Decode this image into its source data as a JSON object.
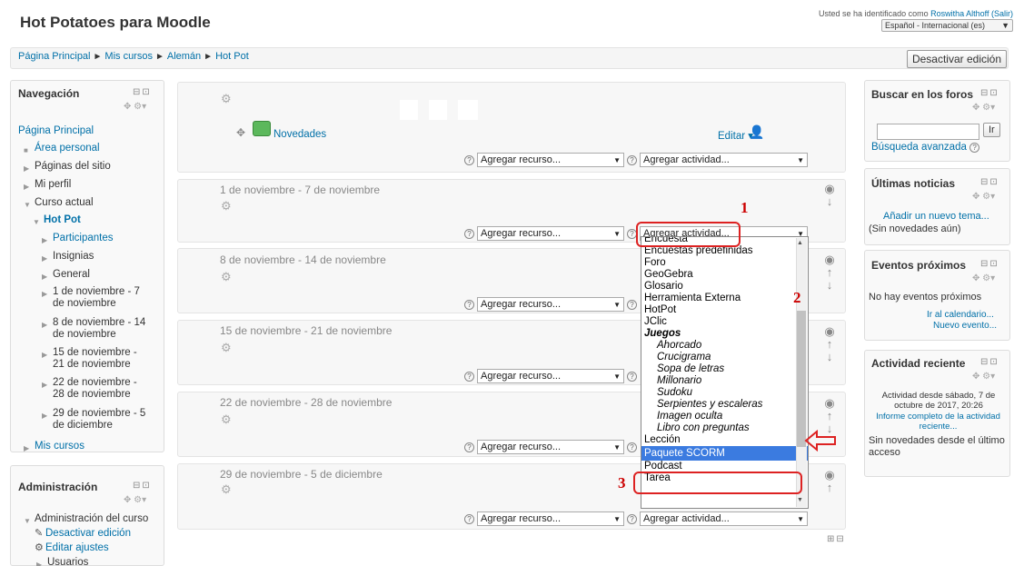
{
  "header": {
    "site_title": "Hot Potatoes para Moodle",
    "login_prefix": "Usted se ha identificado como ",
    "user_name": "Roswitha Althoff",
    "logout": "(Salir)",
    "language": "Español - Internacional (es)"
  },
  "breadcrumb": [
    "Página Principal",
    "Mis cursos",
    "Alemán",
    "Hot Pot"
  ],
  "edit_button": "Desactivar edición",
  "navigation": {
    "title": "Navegación",
    "items": [
      {
        "label": "Página Principal"
      },
      {
        "label": "Área personal"
      },
      {
        "label": "Páginas del sitio"
      },
      {
        "label": "Mi perfil"
      },
      {
        "label": "Curso actual"
      },
      {
        "label": "Hot Pot"
      },
      {
        "label": "Participantes"
      },
      {
        "label": "Insignias"
      },
      {
        "label": "General"
      },
      {
        "label": "1 de noviembre - 7 de noviembre"
      },
      {
        "label": "8 de noviembre - 14 de noviembre"
      },
      {
        "label": "15 de noviembre - 21 de noviembre"
      },
      {
        "label": "22 de noviembre - 28 de noviembre"
      },
      {
        "label": "29 de noviembre - 5 de diciembre"
      },
      {
        "label": "Mis cursos"
      }
    ]
  },
  "administration": {
    "title": "Administración",
    "items": [
      {
        "label": "Administración del curso"
      },
      {
        "label": "Desactivar edición"
      },
      {
        "label": "Editar ajustes"
      },
      {
        "label": "Usuarios"
      }
    ]
  },
  "course": {
    "news_label": "Novedades",
    "edit_label": "Editar",
    "add_resource": "Agregar recurso...",
    "add_activity": "Agregar actividad...",
    "sections": [
      {
        "title": "1 de noviembre - 7 de noviembre"
      },
      {
        "title": "8 de noviembre - 14 de noviembre"
      },
      {
        "title": "15 de noviembre - 21 de noviembre"
      },
      {
        "title": "22 de noviembre - 28 de noviembre"
      },
      {
        "title": "29 de noviembre - 5 de diciembre"
      }
    ]
  },
  "dropdown": {
    "items": [
      {
        "label": "Encuesta",
        "kind": "normal"
      },
      {
        "label": "Encuestas predefinidas",
        "kind": "normal"
      },
      {
        "label": "Foro",
        "kind": "normal"
      },
      {
        "label": "GeoGebra",
        "kind": "normal"
      },
      {
        "label": "Glosario",
        "kind": "normal"
      },
      {
        "label": "Herramienta Externa",
        "kind": "normal"
      },
      {
        "label": "HotPot",
        "kind": "normal"
      },
      {
        "label": "JClic",
        "kind": "normal"
      },
      {
        "label": "Juegos",
        "kind": "group"
      },
      {
        "label": "Ahorcado",
        "kind": "sub"
      },
      {
        "label": "Crucigrama",
        "kind": "sub"
      },
      {
        "label": "Sopa de letras",
        "kind": "sub"
      },
      {
        "label": "Millonario",
        "kind": "sub"
      },
      {
        "label": "Sudoku",
        "kind": "sub"
      },
      {
        "label": "Serpientes y escaleras",
        "kind": "sub"
      },
      {
        "label": "Imagen oculta",
        "kind": "sub"
      },
      {
        "label": "Libro con preguntas",
        "kind": "sub"
      },
      {
        "label": "Lección",
        "kind": "normal"
      },
      {
        "label": "Paquete SCORM",
        "kind": "selected"
      },
      {
        "label": "Podcast",
        "kind": "normal"
      },
      {
        "label": "Tarea",
        "kind": "normal"
      }
    ]
  },
  "annotations": [
    "1",
    "2",
    "3"
  ],
  "search_forums": {
    "title": "Buscar en los foros",
    "go": "Ir",
    "advanced": "Búsqueda avanzada"
  },
  "latest_news": {
    "title": "Últimas noticias",
    "add_topic": "Añadir un nuevo tema...",
    "none": "(Sin novedades aún)"
  },
  "upcoming_events": {
    "title": "Eventos próximos",
    "none": "No hay eventos próximos",
    "calendar": "Ir al calendario...",
    "new_event": "Nuevo evento..."
  },
  "recent_activity": {
    "title": "Actividad reciente",
    "since": "Actividad desde sábado, 7 de octubre de 2017, 20:26",
    "full_report": "Informe completo de la actividad reciente...",
    "none": "Sin novedades desde el último acceso"
  },
  "colors": {
    "link": "#0070a8",
    "annotation": "#cc0000",
    "selected": "#3b7be0"
  }
}
